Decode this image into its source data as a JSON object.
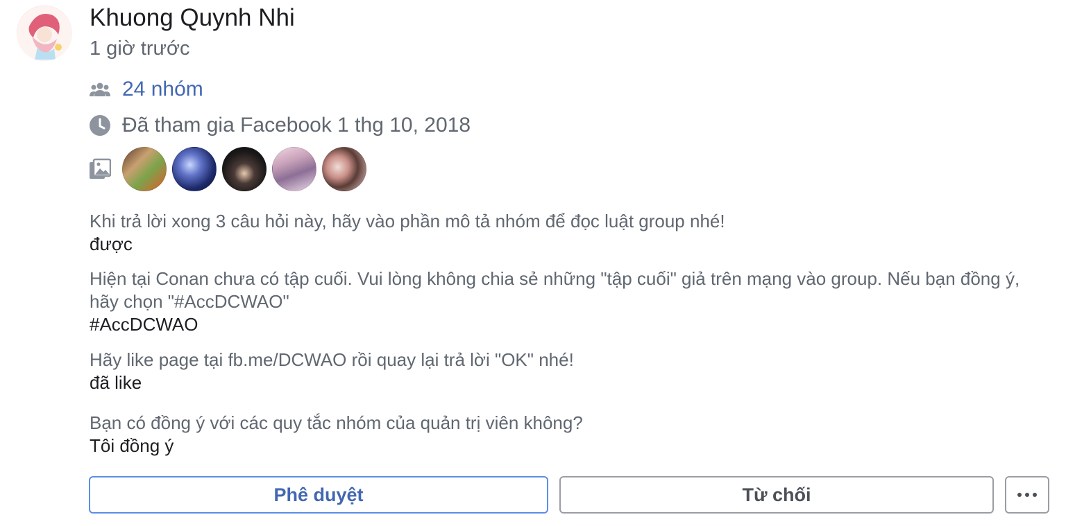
{
  "member": {
    "name": "Khuong Quynh Nhi",
    "time": "1 giờ trước",
    "avatar_icon": "profile-avatar"
  },
  "info": {
    "groups_text": "24 nhóm",
    "joined_text": "Đã tham gia Facebook 1 thg 10, 2018",
    "groups_icon": "people-icon",
    "joined_icon": "clock-icon",
    "photos_icon": "photos-icon"
  },
  "questions": [
    {
      "question": "Khi trả lời xong 3 câu hỏi này, hãy vào phần mô tả nhóm để đọc luật group nhé!",
      "answer": "được"
    },
    {
      "question": "Hiện tại Conan chưa có tập cuối. Vui lòng không chia sẻ những \"tập cuối\" giả trên mạng vào group. Nếu bạn đồng ý, hãy chọn \"#AccDCWAO\"",
      "answer": "#AccDCWAO"
    },
    {
      "question": "Hãy like page tại fb.me/DCWAO rồi quay lại trả lời \"OK\" nhé!",
      "answer": "đã like"
    },
    {
      "question": "Bạn có đồng ý với các quy tắc nhóm của quản trị viên không?",
      "answer": "Tôi đồng ý"
    }
  ],
  "actions": {
    "approve_label": "Phê duyệt",
    "decline_label": "Từ chối",
    "more_icon": "more-options-icon"
  },
  "colors": {
    "link_blue": "#4267b2",
    "approve_border": "#5b8ee6",
    "secondary_text": "#606770",
    "primary_text": "#1c1e21"
  }
}
